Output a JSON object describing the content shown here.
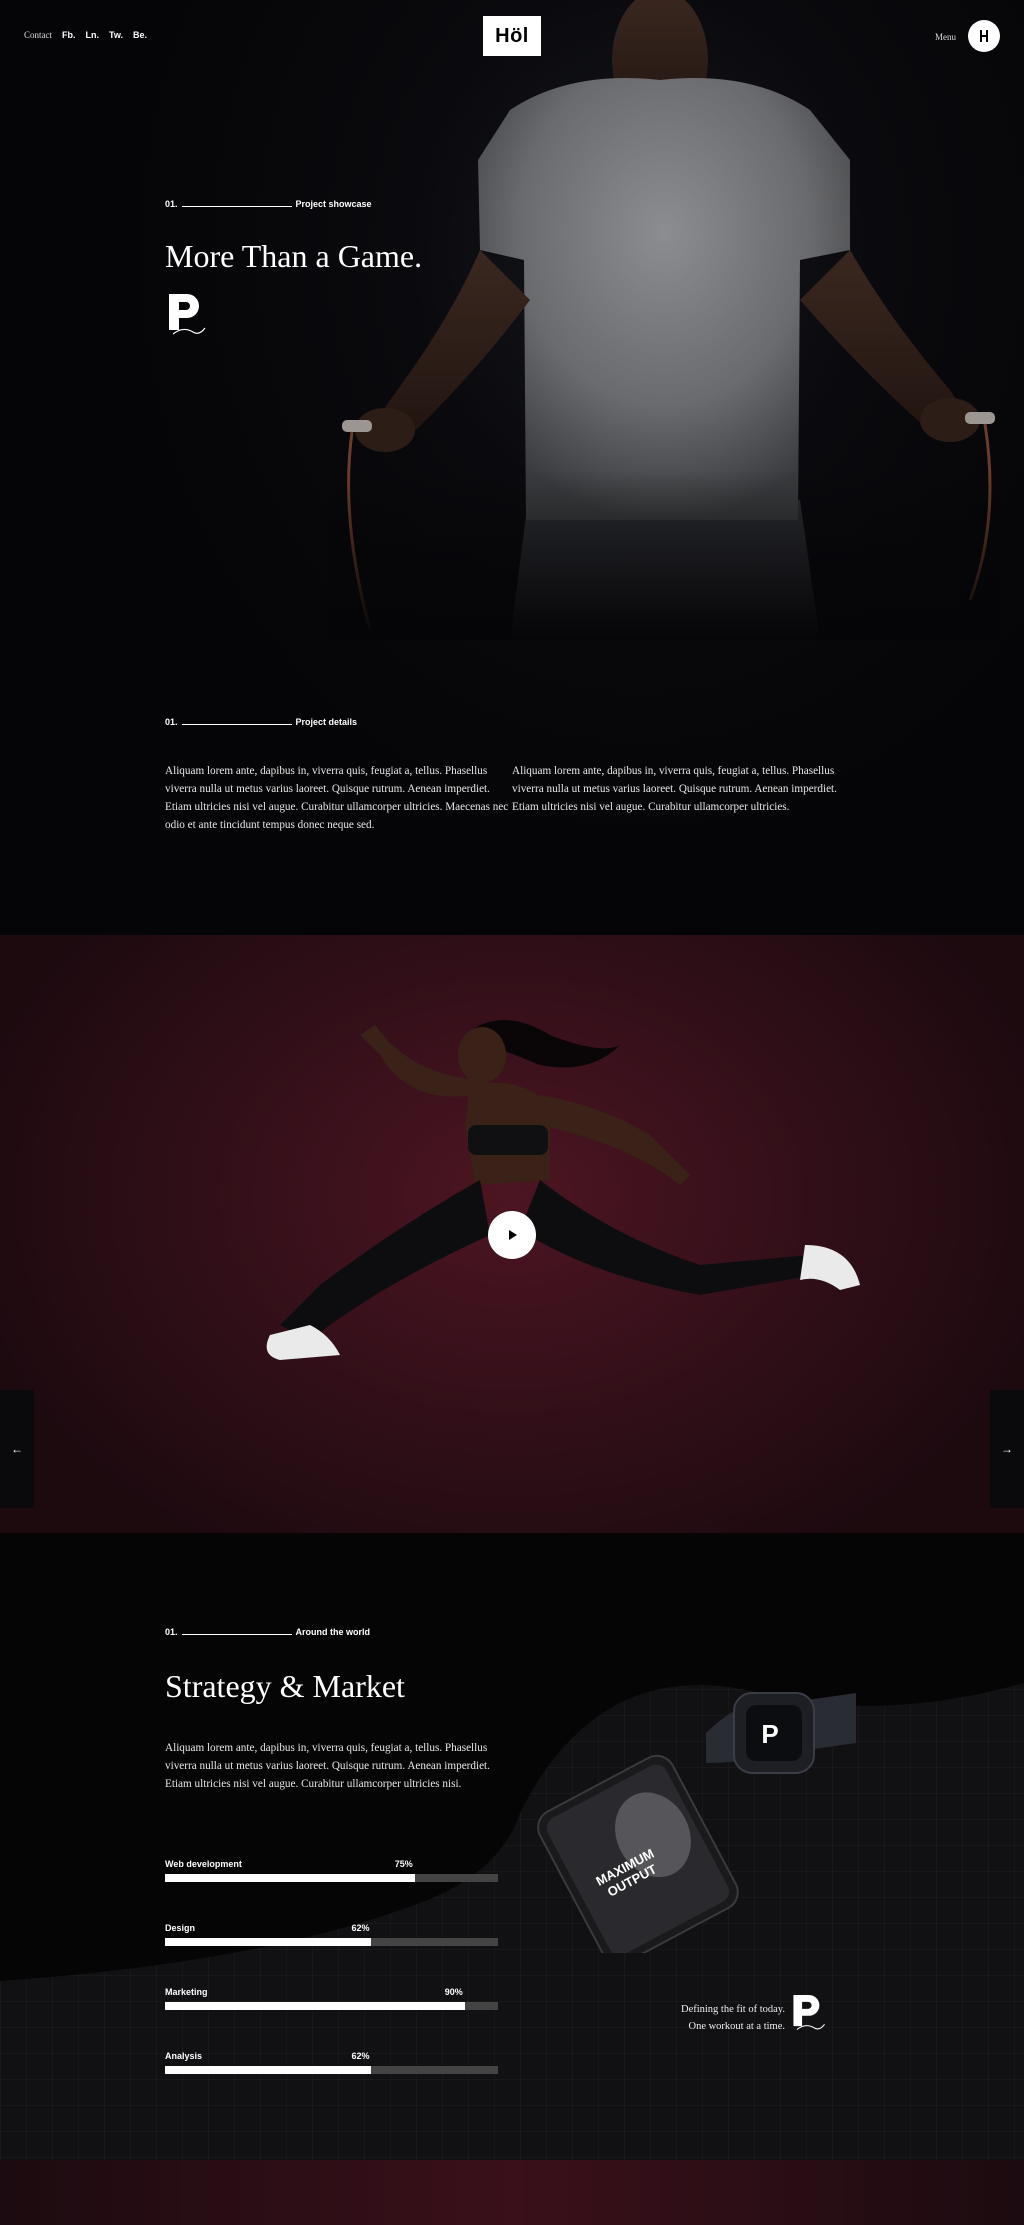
{
  "header": {
    "contact": "Contact",
    "social": [
      "Fb.",
      "Ln.",
      "Tw.",
      "Be."
    ],
    "logo": "Höl",
    "menu": "Menu"
  },
  "hero": {
    "eyebrow_num": "01.",
    "eyebrow_label": "Project showcase",
    "title": "More Than a Game."
  },
  "details": {
    "eyebrow_num": "01.",
    "eyebrow_label": "Project details",
    "col1": "Aliquam lorem ante, dapibus in, viverra quis, feugiat a, tellus. Phasellus viverra nulla ut metus varius laoreet. Quisque rutrum. Aenean imperdiet. Etiam ultricies nisi vel augue. Curabitur ullamcorper ultricies. Maecenas nec odio et ante tincidunt tempus donec neque sed.",
    "col2": "Aliquam lorem ante, dapibus in, viverra quis, feugiat a, tellus. Phasellus viverra nulla ut metus varius laoreet. Quisque rutrum. Aenean imperdiet. Etiam ultricies nisi vel augue. Curabitur ullamcorper ultricies."
  },
  "video": {
    "prev_arrow": "←",
    "next_arrow": "→"
  },
  "strategy": {
    "eyebrow_num": "01.",
    "eyebrow_label": "Around the world",
    "title": "Strategy & Market",
    "text": "Aliquam lorem ante, dapibus in, viverra quis, feugiat a, tellus. Phasellus viverra nulla ut metus varius laoreet. Quisque rutrum. Aenean imperdiet. Etiam ultricies nisi vel augue. Curabitur ullamcorper ultricies nisi.",
    "skills": [
      {
        "label": "Web development",
        "value": "75%",
        "fraction": 0.75
      },
      {
        "label": "Design",
        "value": "62%",
        "fraction": 0.62
      },
      {
        "label": "Marketing",
        "value": "90%",
        "fraction": 0.9
      },
      {
        "label": "Analysis",
        "value": "62%",
        "fraction": 0.62
      }
    ],
    "phone_text_1": "MAXIMUM",
    "phone_text_2": "OUTPUT",
    "tagline_1": "Defining the fit of today.",
    "tagline_2": "One workout at a time."
  },
  "brand": {
    "mark_letter": "P",
    "mark_script": "art"
  },
  "colors": {
    "background": "#050507",
    "accent_wine": "#4c1522",
    "bar_track": "#444444",
    "bar_fill": "#ffffff"
  }
}
